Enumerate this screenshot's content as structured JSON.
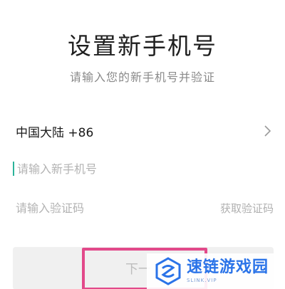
{
  "header": {
    "title": "设置新手机号",
    "subtitle": "请输入您的新手机号并验证"
  },
  "form": {
    "region": {
      "label": "中国大陆 +86",
      "chevron_icon": "chevron-right-icon"
    },
    "phone": {
      "value": "",
      "placeholder": "请输入新手机号"
    },
    "code": {
      "value": "",
      "placeholder": "请输入验证码",
      "get_code_label": "获取验证码"
    },
    "next_label": "下一"
  },
  "watermark": {
    "name": "速链游戏园",
    "url": "SLINK.VIP",
    "logo_icon": "slink-logo-icon"
  },
  "colors": {
    "accent_caret": "#2bb39a",
    "highlight_box": "#e2498a",
    "watermark_blue": "#2a73e8"
  }
}
